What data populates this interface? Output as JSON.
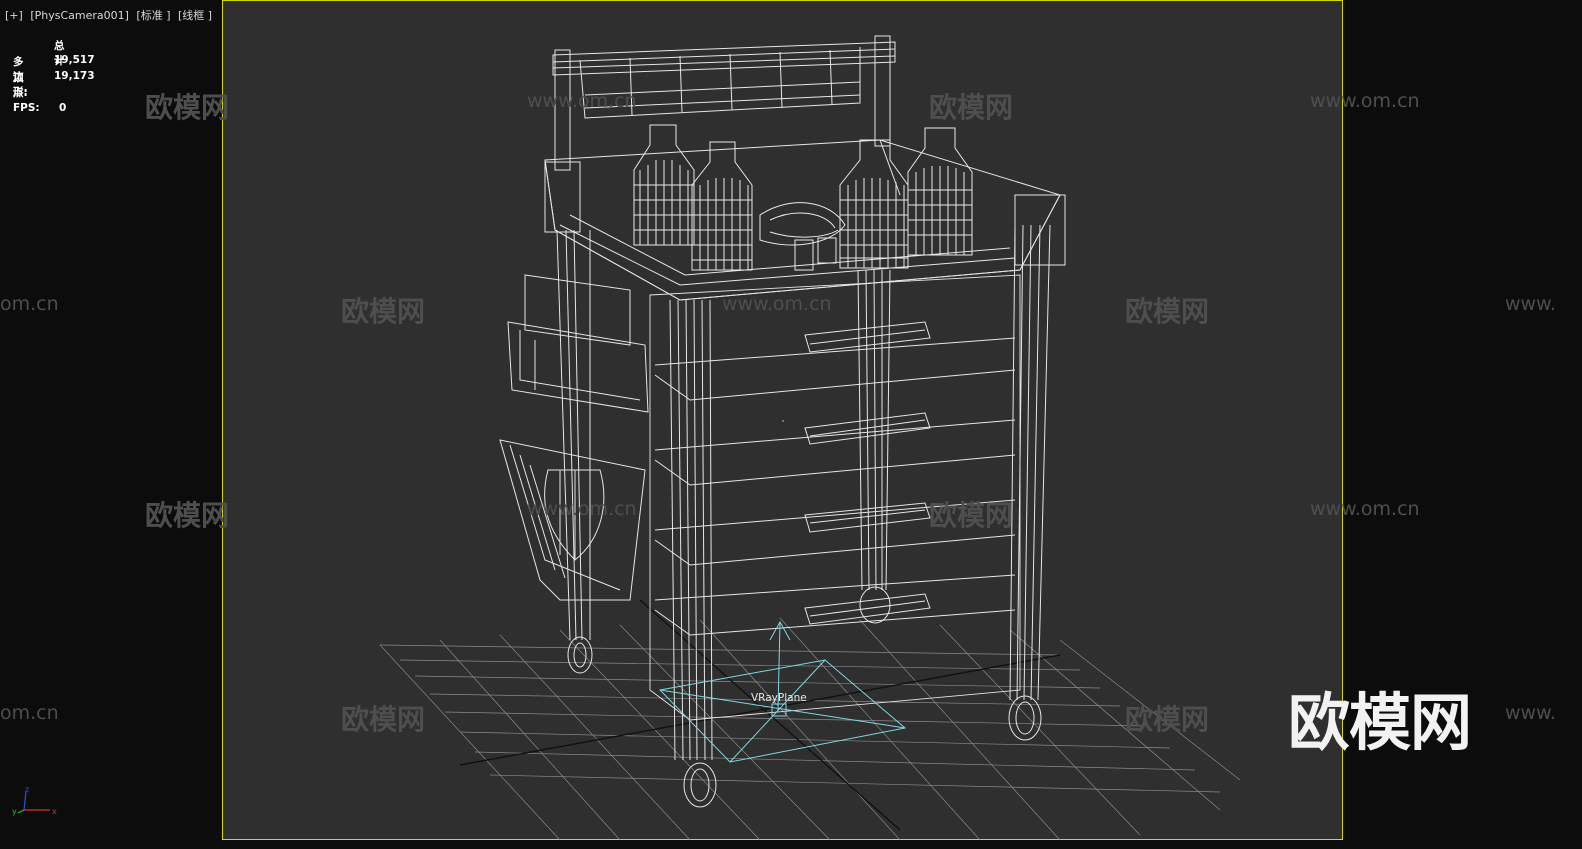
{
  "viewport": {
    "labels": [
      "[+]",
      "[PhysCamera001]",
      "[标准 ]",
      "[线框 ]"
    ]
  },
  "stats": {
    "header": "总计",
    "polygons_label": "多边形:",
    "polygons_value": "19,517",
    "vertices_label": "顶点:",
    "vertices_value": "19,173",
    "fps_label": "FPS:",
    "fps_value": "0"
  },
  "scene": {
    "object_label": "VRayPlane",
    "frame_color": "#d8d800",
    "wire_color": "#e6e6e6",
    "helper_color": "#7fd8e0"
  },
  "watermarks": {
    "brand": "欧模网",
    "url": "www.om.cn",
    "url_partial_left": "om.cn",
    "url_partial_right": "www."
  },
  "axis": {
    "x": "x",
    "y": "y",
    "z": "z"
  }
}
